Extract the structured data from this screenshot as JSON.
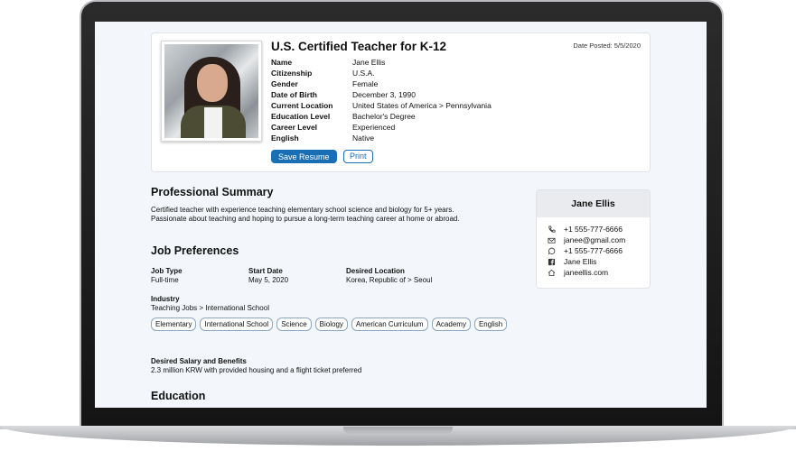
{
  "profile": {
    "title": "U.S. Certified Teacher for K-12",
    "date_posted": "Date Posted: 5/5/2020",
    "fields": [
      {
        "label": "Name",
        "value": "Jane Ellis"
      },
      {
        "label": "Citizenship",
        "value": "U.S.A."
      },
      {
        "label": "Gender",
        "value": "Female"
      },
      {
        "label": "Date of Birth",
        "value": "December 3, 1990"
      },
      {
        "label": "Current Location",
        "value": "United States of America > Pennsylvania"
      },
      {
        "label": "Education Level",
        "value": "Bachelor's Degree"
      },
      {
        "label": "Career Level",
        "value": "Experienced"
      },
      {
        "label": "English",
        "value": "Native"
      }
    ],
    "save_label": "Save Resume",
    "print_label": "Print"
  },
  "summary": {
    "heading": "Professional Summary",
    "line1": "Certified teacher with experience teaching elementary school science and biology for 5+ years.",
    "line2": "Passionate about teaching and hoping to pursue a long-term teaching career at home or abroad."
  },
  "preferences": {
    "heading": "Job Preferences",
    "job_type_label": "Job Type",
    "job_type": "Full-time",
    "start_date_label": "Start Date",
    "start_date": "May 5, 2020",
    "location_label": "Desired Location",
    "location": "Korea, Republic of > Seoul",
    "industry_label": "Industry",
    "industry": "Teaching Jobs > International School",
    "tags": [
      "Elementary",
      "International School",
      "Science",
      "Biology",
      "American Curriculum",
      "Academy",
      "English"
    ],
    "salary_label": "Desired Salary and Benefits",
    "salary": "2.3 million KRW with provided housing and a flight ticket preferred"
  },
  "education": {
    "heading": "Education"
  },
  "contact": {
    "name": "Jane Ellis",
    "items": [
      {
        "icon": "phone-icon",
        "value": "+1 555-777-6666"
      },
      {
        "icon": "email-icon",
        "value": "janee@gmail.com"
      },
      {
        "icon": "whatsapp-icon",
        "value": "+1 555-777-6666"
      },
      {
        "icon": "facebook-icon",
        "value": "Jane Ellis"
      },
      {
        "icon": "home-icon",
        "value": "janeellis.com"
      }
    ]
  },
  "colors": {
    "accent": "#1a6fb4",
    "tag_border": "#8aa6c1",
    "screen_bg": "#f3f7fb"
  }
}
